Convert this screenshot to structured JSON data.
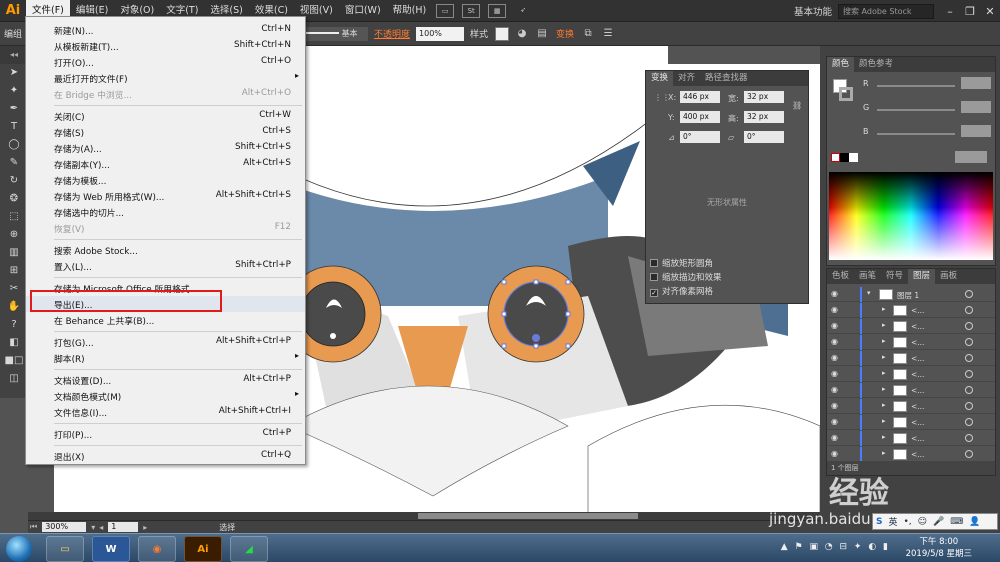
{
  "app": {
    "logo": "Ai"
  },
  "menubar": {
    "items": [
      "文件(F)",
      "编辑(E)",
      "对象(O)",
      "文字(T)",
      "选择(S)",
      "效果(C)",
      "视图(V)",
      "窗口(W)",
      "帮助(H)"
    ],
    "badge": "St",
    "workspace": "基本功能",
    "search_placeholder": "搜索 Adobe Stock"
  },
  "controlbar": {
    "mode": "编组",
    "stroke_style": "基本",
    "opacity_label": "不透明度",
    "opacity_value": "100%",
    "style_label": "样式",
    "transform_link": "变换"
  },
  "file_menu": {
    "items": [
      {
        "label": "新建(N)...",
        "shortcut": "Ctrl+N"
      },
      {
        "label": "从模板新建(T)...",
        "shortcut": "Shift+Ctrl+N"
      },
      {
        "label": "打开(O)...",
        "shortcut": "Ctrl+O"
      },
      {
        "label": "最近打开的文件(F)",
        "shortcut": ""
      },
      {
        "label": "在 Bridge 中浏览...",
        "shortcut": "Alt+Ctrl+O"
      },
      {
        "label": "关闭(C)",
        "shortcut": "Ctrl+W"
      },
      {
        "label": "存储(S)",
        "shortcut": "Ctrl+S"
      },
      {
        "label": "存储为(A)...",
        "shortcut": "Shift+Ctrl+S"
      },
      {
        "label": "存储副本(Y)...",
        "shortcut": "Alt+Ctrl+S"
      },
      {
        "label": "存储为模板...",
        "shortcut": ""
      },
      {
        "label": "存储为 Web 所用格式(W)...",
        "shortcut": "Alt+Shift+Ctrl+S"
      },
      {
        "label": "存储选中的切片...",
        "shortcut": ""
      },
      {
        "label": "恢复(V)",
        "shortcut": "F12"
      },
      {
        "label": "搜索 Adobe Stock...",
        "shortcut": ""
      },
      {
        "label": "置入(L)...",
        "shortcut": "Shift+Ctrl+P"
      },
      {
        "label": "存储为 Microsoft Office 所用格式...",
        "shortcut": ""
      },
      {
        "label": "导出(E)...",
        "shortcut": ""
      },
      {
        "label": "在 Behance 上共享(B)...",
        "shortcut": ""
      },
      {
        "label": "打包(G)...",
        "shortcut": "Alt+Shift+Ctrl+P"
      },
      {
        "label": "脚本(R)",
        "shortcut": ""
      },
      {
        "label": "文档设置(D)...",
        "shortcut": "Alt+Ctrl+P"
      },
      {
        "label": "文档颜色模式(M)",
        "shortcut": ""
      },
      {
        "label": "文件信息(I)...",
        "shortcut": "Alt+Shift+Ctrl+I"
      },
      {
        "label": "打印(P)...",
        "shortcut": "Ctrl+P"
      },
      {
        "label": "退出(X)",
        "shortcut": "Ctrl+Q"
      }
    ]
  },
  "transform_panel": {
    "tabs": [
      "变换",
      "对齐",
      "路径查找器"
    ],
    "x_label": "X:",
    "x_value": "446 px",
    "y_label": "Y:",
    "y_value": "400 px",
    "w_label": "宽:",
    "w_value": "32 px",
    "h_label": "高:",
    "h_value": "32 px",
    "angle_value": "0°",
    "shear_value": "0°",
    "no_shape_text": "无形状属性",
    "checks": [
      "缩放矩形圆角",
      "缩放描边和效果",
      "对齐像素网格"
    ]
  },
  "color_panel": {
    "tabs": [
      "颜色",
      "颜色参考"
    ],
    "channels": [
      "R",
      "G",
      "B"
    ]
  },
  "layers_panel": {
    "tabs": [
      "色板",
      "画笔",
      "符号",
      "图层",
      "画板"
    ],
    "layer_name": "图层 1",
    "sublayer_label": "<...",
    "footer": "1 个图层"
  },
  "statusbar": {
    "zoom": "300%",
    "artboard": "1",
    "status": "选择"
  },
  "taskbar": {
    "apps": [
      "W",
      "Ai"
    ],
    "time": "下午 8:00",
    "date": "2019/5/8 星期三"
  },
  "watermark": {
    "brand": "Bai 经验",
    "url": "jingyan.baidu.com"
  },
  "ime": {
    "lang": "英"
  },
  "colors": {
    "accent_orange": "#ff7a2f",
    "highlight_red": "#e01b1b",
    "owl_blue": "#6b89a8",
    "owl_orange": "#e89a50"
  }
}
